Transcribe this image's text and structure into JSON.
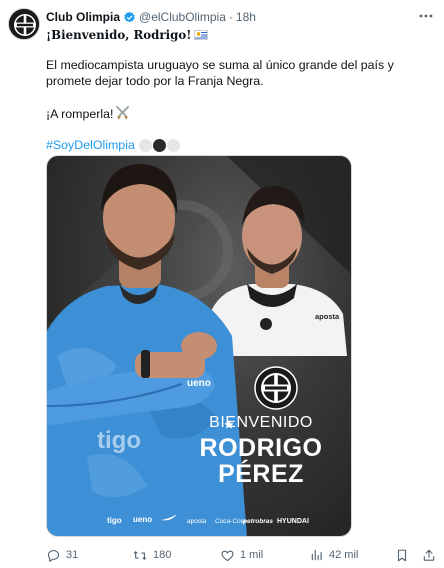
{
  "account": {
    "display_name": "Club Olimpia",
    "handle": "@elClubOlimpia",
    "separator": "·",
    "time": "18h"
  },
  "tweet": {
    "line1": "¡Bienvenido, Rodrigo!",
    "body": "El mediocampista uruguayo se suma al único grande del país y promete dejar todo por la Franja Negra.",
    "cheer": "¡A romperla!",
    "hashtag": "#SoyDelOlimpia"
  },
  "media": {
    "welcome": "BIENVENIDO",
    "first_name": "RODRIGO",
    "last_name": "PÉREZ",
    "sponsors": [
      "tigo",
      "ueno",
      "nike",
      "aposta",
      "coca-cola",
      "petrobras",
      "hyundai"
    ]
  },
  "actions": {
    "replies": "31",
    "reposts": "180",
    "likes": "1 mil",
    "views": "42 mil"
  },
  "colors": {
    "accent": "#1d9bf0",
    "verified": "#1d9bf0",
    "secondary_text": "#536471",
    "jersey_blue": "#3d8fd6"
  },
  "icons": {
    "verified": "verified-badge-icon",
    "more": "more-icon",
    "reply": "reply-icon",
    "repost": "repost-icon",
    "like": "like-icon",
    "views": "views-icon",
    "bookmark": "bookmark-icon",
    "share": "share-icon"
  }
}
